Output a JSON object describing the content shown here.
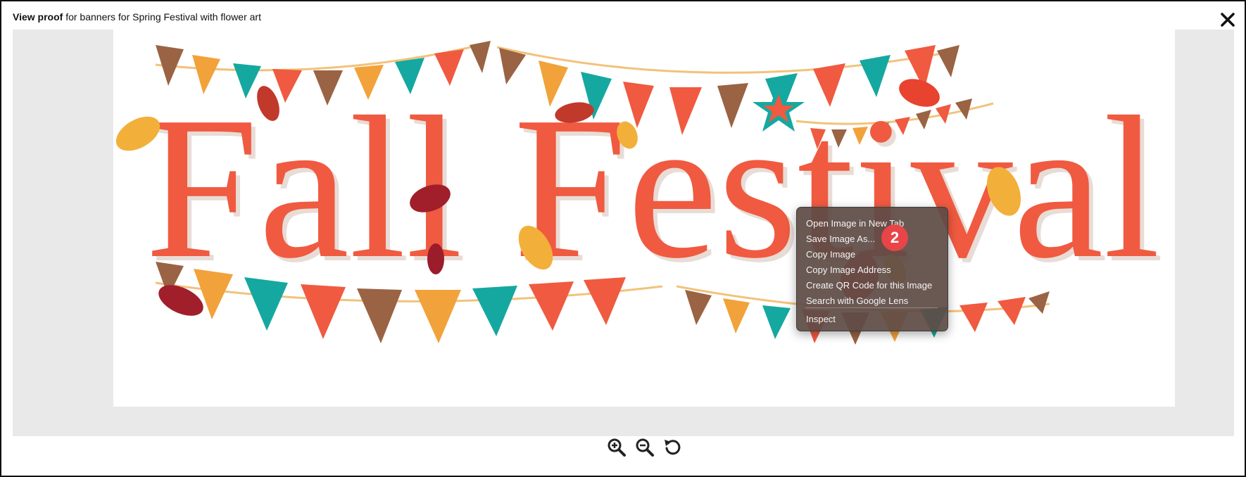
{
  "header": {
    "bold_label": "View proof",
    "rest_label": " for banners for Spring Festival with flower art"
  },
  "proof_image": {
    "title_text": "Fall Festival"
  },
  "context_menu": {
    "items": [
      "Open Image in New Tab",
      "Save Image As...",
      "Copy Image",
      "Copy Image Address",
      "Create QR Code for this Image",
      "Search with Google Lens",
      "Inspect"
    ]
  },
  "step_badge": {
    "number": "2"
  },
  "toolbar": {
    "zoom_in_icon": "zoom-in-icon",
    "zoom_out_icon": "zoom-out-icon",
    "reset_icon": "rotate-icon"
  },
  "colors": {
    "red": "#f05a40",
    "teal": "#15a8a0",
    "orange": "#f2a23a",
    "brown": "#9a6344",
    "badge": "#e84548"
  }
}
